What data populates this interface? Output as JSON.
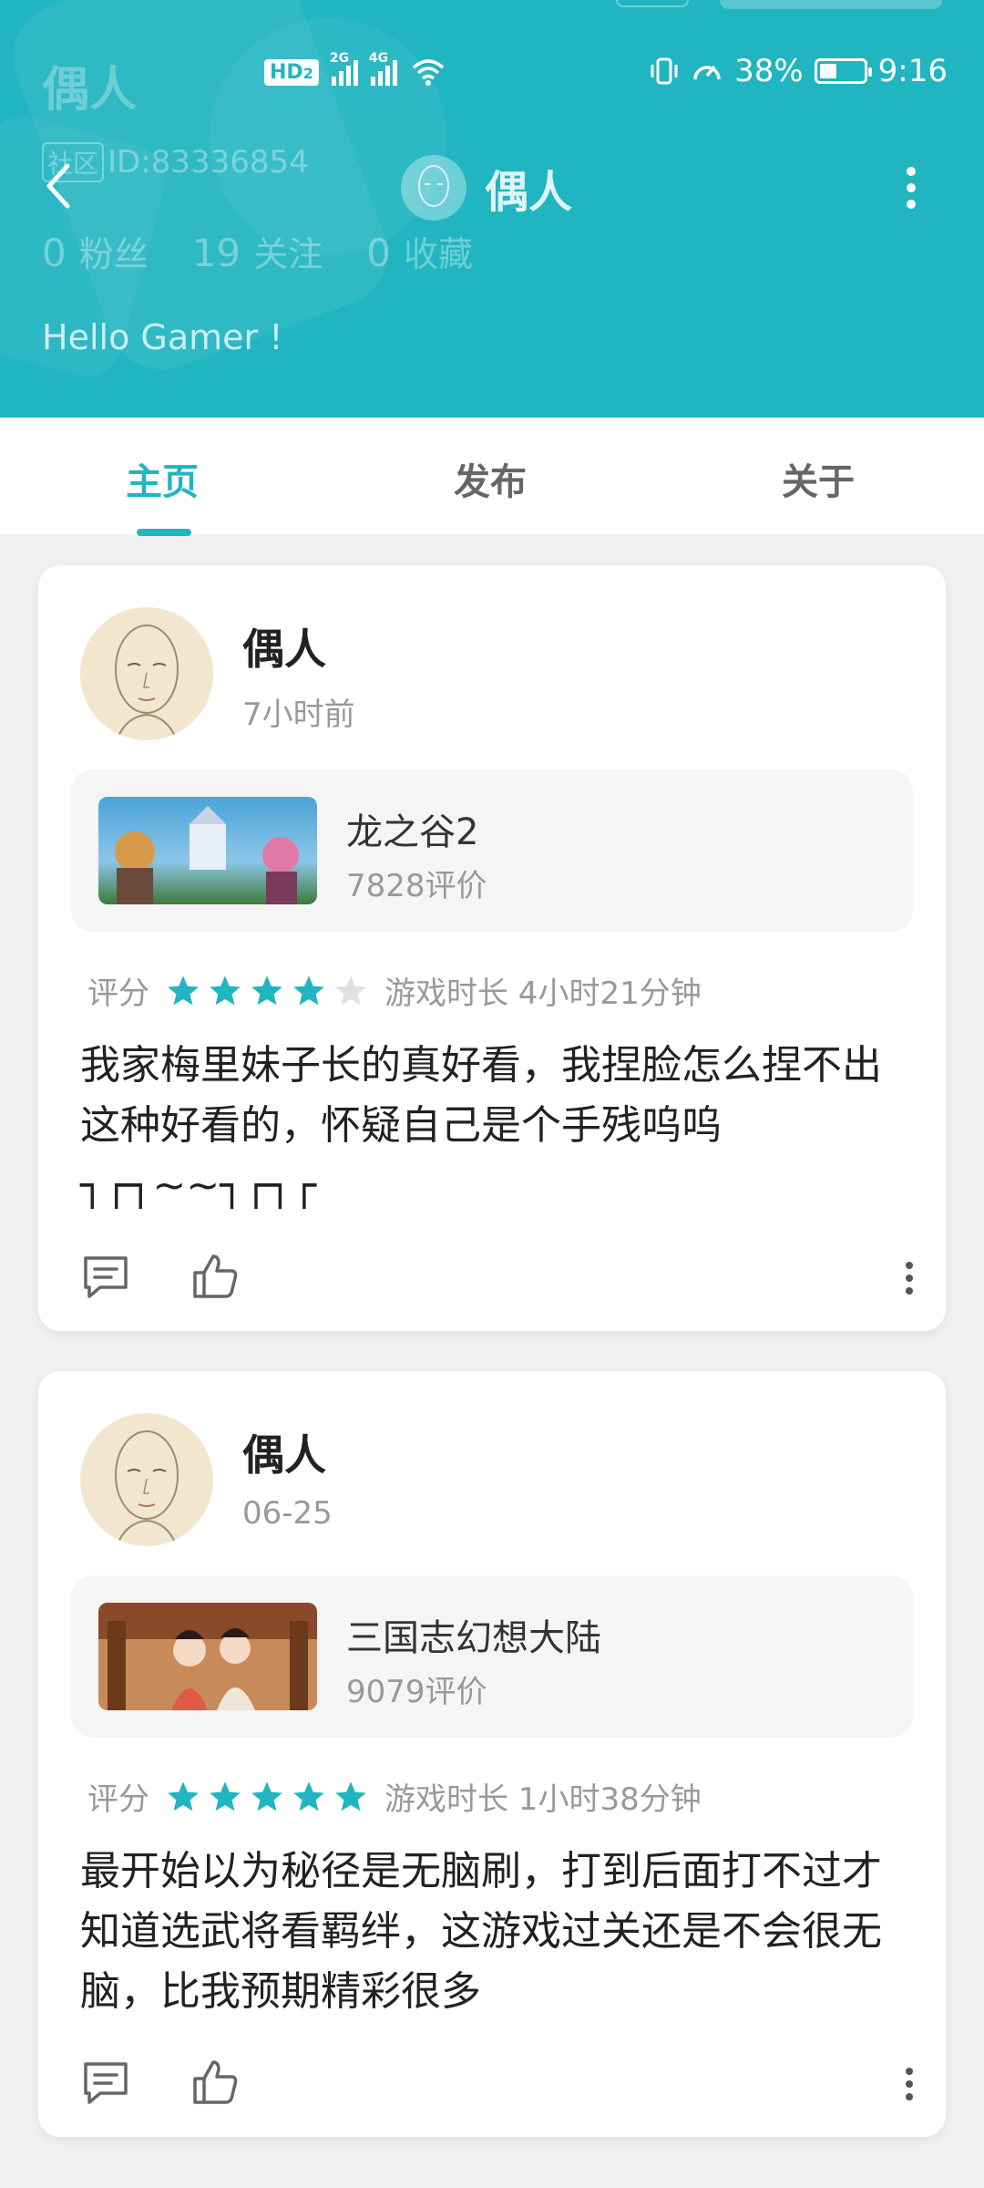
{
  "status_bar": {
    "hd_label": "HD",
    "hd_sub": "2",
    "signal1_tag": "2G",
    "signal2_tag": "4G",
    "battery": "38%",
    "time": "9:16"
  },
  "profile": {
    "name": "偶人",
    "id_tag": "社区",
    "id_text": "ID:83336854",
    "stats": [
      {
        "count": "0",
        "label": "粉丝"
      },
      {
        "count": "19",
        "label": "关注"
      },
      {
        "count": "0",
        "label": "收藏"
      }
    ],
    "greeting": "Hello Gamer !"
  },
  "nav": {
    "title": "偶人",
    "back_icon": "chevron-left-icon",
    "more_icon": "more-vertical-icon"
  },
  "tabs": [
    {
      "label": "主页",
      "active": true
    },
    {
      "label": "发布",
      "active": false
    },
    {
      "label": "关于",
      "active": false
    }
  ],
  "colors": {
    "accent": "#21b5c1",
    "star_off": "#e0e0e0"
  },
  "posts": [
    {
      "author": "偶人",
      "time": "7小时前",
      "game_name": "龙之谷2",
      "game_reviews": "7828评价",
      "rating_label": "评分",
      "stars": 4,
      "playtime": "游戏时长 4小时21分钟",
      "content": "我家梅里妹子长的真好看，我捏脸怎么捏不出这种好看的，怀疑自己是个手残呜呜┐┌┐~~┐┌┐┌"
    },
    {
      "author": "偶人",
      "time": "06-25",
      "game_name": "三国志幻想大陆",
      "game_reviews": "9079评价",
      "rating_label": "评分",
      "stars": 5,
      "playtime": "游戏时长 1小时38分钟",
      "content": "最开始以为秘径是无脑刷，打到后面打不过才知道选武将看羁绊，这游戏过关还是不会很无脑，比我预期精彩很多"
    }
  ]
}
